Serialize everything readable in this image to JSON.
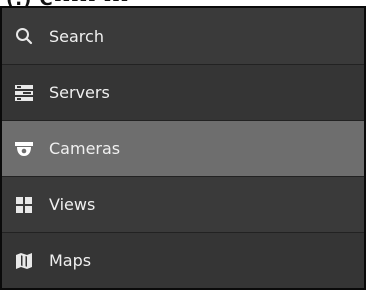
{
  "top_fragment": "(.) C----- ---",
  "menu": {
    "items": [
      {
        "label": "Search",
        "icon": "search-icon"
      },
      {
        "label": "Servers",
        "icon": "server-icon"
      },
      {
        "label": "Cameras",
        "icon": "camera-icon",
        "selected": true
      },
      {
        "label": "Views",
        "icon": "grid-icon"
      },
      {
        "label": "Maps",
        "icon": "map-icon"
      }
    ]
  },
  "colors": {
    "panel_bg": "#3c3c3c",
    "selected_bg": "#6e6e6e",
    "text": "#f0f0f0",
    "border": "#0a0a0a"
  }
}
